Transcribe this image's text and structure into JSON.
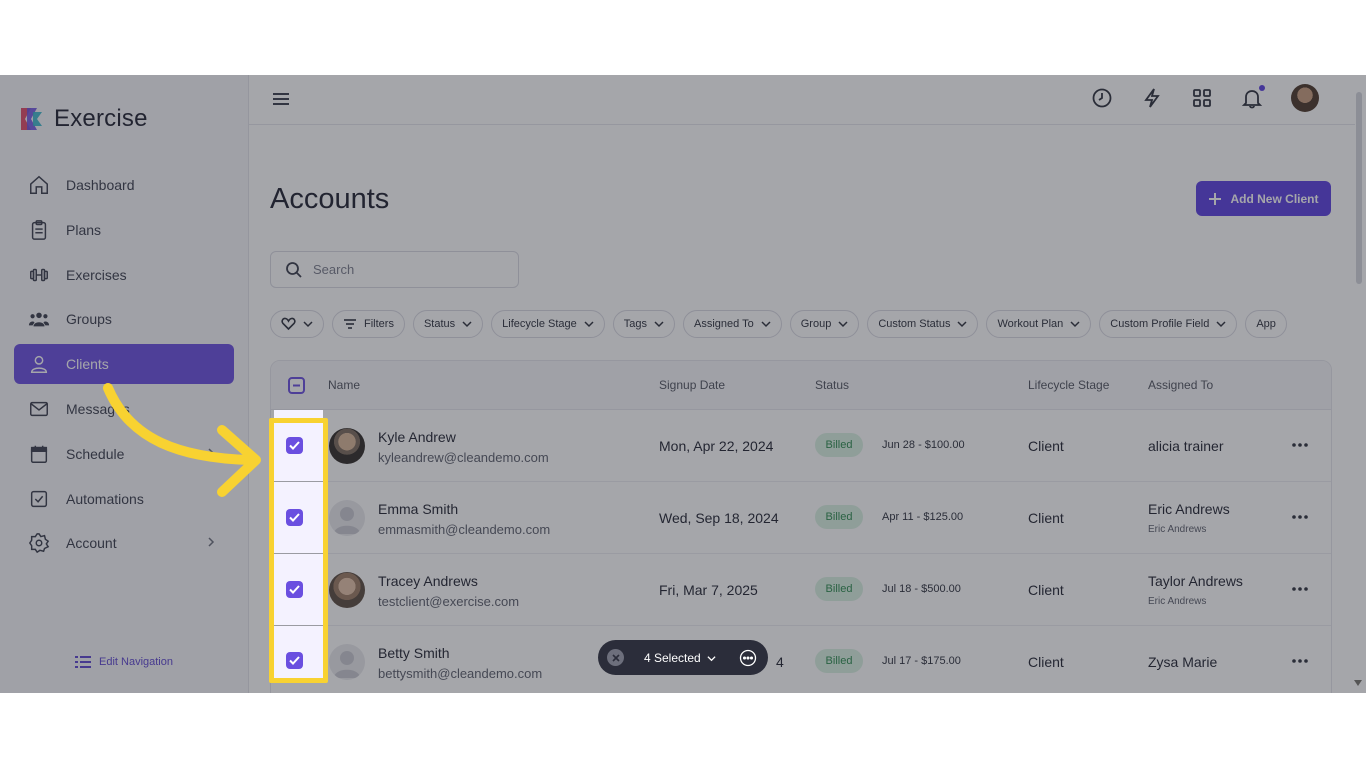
{
  "app": {
    "name": "Exercise"
  },
  "sidebar": {
    "items": [
      {
        "label": "Dashboard",
        "icon": "home-icon"
      },
      {
        "label": "Plans",
        "icon": "clipboard-icon"
      },
      {
        "label": "Exercises",
        "icon": "dumbbell-icon"
      },
      {
        "label": "Groups",
        "icon": "users-icon"
      },
      {
        "label": "Clients",
        "icon": "user-icon",
        "active": true
      },
      {
        "label": "Messages",
        "icon": "mail-icon"
      },
      {
        "label": "Schedule",
        "icon": "calendar-icon"
      },
      {
        "label": "Automations",
        "icon": "checkbox-icon"
      },
      {
        "label": "Account",
        "icon": "gear-icon"
      }
    ],
    "edit_navigation": "Edit Navigation"
  },
  "header": {
    "icons": [
      "clock-icon",
      "lightning-icon",
      "grid-icon",
      "bell-icon",
      "avatar"
    ]
  },
  "page": {
    "title": "Accounts",
    "add_button": "Add New Client",
    "search_placeholder": "Search"
  },
  "filters": [
    "Filters",
    "Status",
    "Lifecycle Stage",
    "Tags",
    "Assigned To",
    "Group",
    "Custom Status",
    "Workout Plan",
    "Custom Profile Field",
    "App"
  ],
  "table": {
    "columns": [
      "Name",
      "Signup Date",
      "Status",
      "Lifecycle Stage",
      "Assigned To"
    ],
    "rows": [
      {
        "name": "Kyle Andrew",
        "email": "kyleandrew@cleandemo.com",
        "signup": "Mon, Apr 22, 2024",
        "status": "Billed",
        "billing": "Jun 28 - $100.00",
        "stage": "Client",
        "assigned": "alicia trainer",
        "assigned_sub": ""
      },
      {
        "name": "Emma Smith",
        "email": "emmasmith@cleandemo.com",
        "signup": "Wed, Sep 18, 2024",
        "status": "Billed",
        "billing": "Apr 11 - $125.00",
        "stage": "Client",
        "assigned": "Eric Andrews",
        "assigned_sub": "Eric Andrews"
      },
      {
        "name": "Tracey Andrews",
        "email": "testclient@exercise.com",
        "signup": "Fri, Mar 7, 2025",
        "status": "Billed",
        "billing": "Jul 18 - $500.00",
        "stage": "Client",
        "assigned": "Taylor Andrews",
        "assigned_sub": "Eric Andrews"
      },
      {
        "name": "Betty Smith",
        "email": "bettysmith@cleandemo.com",
        "signup": "4",
        "status": "Billed",
        "billing": "Jul 17 - $175.00",
        "stage": "Client",
        "assigned": "Zysa Marie",
        "assigned_sub": ""
      }
    ]
  },
  "bulk_bar": {
    "label": "4 Selected"
  },
  "colors": {
    "accent": "#6a4fe0",
    "highlight": "#f8d231",
    "billed_bg": "#d9f2e2",
    "billed_text": "#2c8a4e"
  }
}
